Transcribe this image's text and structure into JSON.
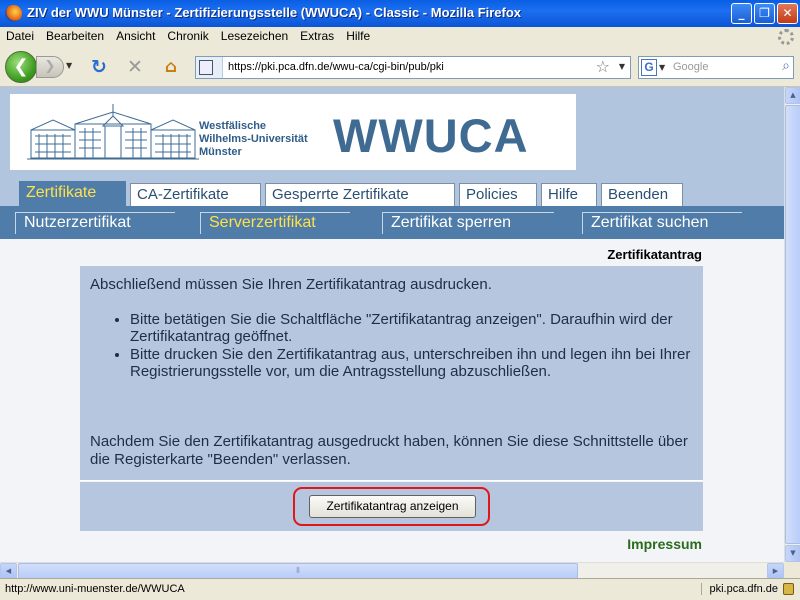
{
  "window": {
    "title": "ZIV der WWU Münster - Zertifizierungsstelle (WWUCA) - Classic - Mozilla Firefox",
    "minimize": "_",
    "maximize": "❐",
    "close": "✕"
  },
  "menu": [
    "Datei",
    "Bearbeiten",
    "Ansicht",
    "Chronik",
    "Lesezeichen",
    "Extras",
    "Hilfe"
  ],
  "toolbar": {
    "url": "https://pki.pca.dfn.de/wwu-ca/cgi-bin/pub/pki",
    "search_placeholder": "Google",
    "search_engine": "G"
  },
  "header": {
    "university_line1": "Westfälische",
    "university_line2": "Wilhelms-Universität",
    "university_line3": "Münster",
    "brand": "WWUCA"
  },
  "tabs": [
    {
      "label": "Zertifikate",
      "active": true
    },
    {
      "label": "CA-Zertifikate",
      "active": false
    },
    {
      "label": "Gesperrte Zertifikate",
      "active": false
    },
    {
      "label": "Policies",
      "active": false
    },
    {
      "label": "Hilfe",
      "active": false
    },
    {
      "label": "Beenden",
      "active": false
    }
  ],
  "subnav": [
    {
      "label": "Nutzerzertifikat",
      "active": false
    },
    {
      "label": "Serverzertifikat",
      "active": true
    },
    {
      "label": "Zertifikat sperren",
      "active": false
    },
    {
      "label": "Zertifikat suchen",
      "active": false
    }
  ],
  "page": {
    "section_title": "Zertifikatantrag",
    "intro": "Abschließend müssen Sie Ihren Zertifikatantrag ausdrucken.",
    "steps": [
      "Bitte betätigen Sie die Schaltfläche \"Zertifikatantrag anzeigen\". Daraufhin wird der Zertifikatantrag geöffnet.",
      "Bitte drucken Sie den Zertifikatantrag aus, unterschreiben ihn und legen ihn bei Ihrer Registrierungsstelle vor, um die Antragsstellung abzuschließen."
    ],
    "outro": "Nachdem Sie den Zertifikatantrag ausgedruckt haben, können Sie diese Schnittstelle über die Registerkarte \"Beenden\" verlassen.",
    "button_label": "Zertifikatantrag anzeigen",
    "impressum": "Impressum"
  },
  "status": {
    "left": "http://www.uni-muenster.de/WWUCA",
    "right": "pki.pca.dfn.de"
  },
  "colors": {
    "accent": "#4f7ca8",
    "active_tab_text": "#ffe14a",
    "highlight": "#e0161a"
  }
}
